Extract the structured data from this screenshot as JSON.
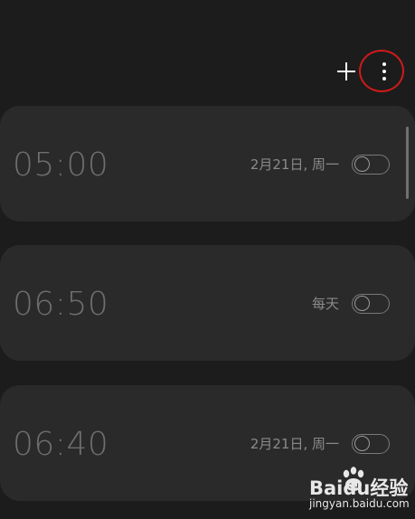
{
  "toolbar": {
    "add_icon": "plus-icon",
    "more_icon": "more-vertical-icon",
    "highlight_color": "#d01a1a"
  },
  "alarms": [
    {
      "time": "05:00",
      "repeat": "2月21日, 周一",
      "enabled": false
    },
    {
      "time": "06:50",
      "repeat": "每天",
      "enabled": false
    },
    {
      "time": "06:40",
      "repeat": "2月21日, 周一",
      "enabled": false
    }
  ],
  "colors": {
    "background": "#1c1c1c",
    "card": "#2a2a2a",
    "time_text": "#6e6e6e",
    "repeat_text": "#8a8a8a"
  },
  "watermark": {
    "brand": "Baidu经验",
    "url": "jingyan.baidu.com"
  }
}
